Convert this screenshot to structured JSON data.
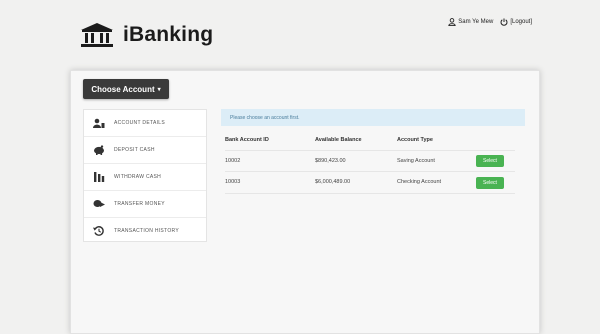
{
  "app": {
    "name": "iBanking"
  },
  "header": {
    "user_label": "Sam Ye Mew",
    "logout_label": "[Logout]"
  },
  "account_menu": {
    "button_label": "Choose Account",
    "caret": "▾"
  },
  "sidebar": {
    "items": [
      {
        "label": "ACCOUNT DETAILS",
        "icon": "bank-icon"
      },
      {
        "label": "DEPOSIT CASH",
        "icon": "piggy-bank-icon"
      },
      {
        "label": "WITHDRAW CASH",
        "icon": "cash-withdraw-icon"
      },
      {
        "label": "TRANSFER MONEY",
        "icon": "transfer-icon"
      },
      {
        "label": "TRANSACTION HISTORY",
        "icon": "history-icon"
      }
    ]
  },
  "alert": {
    "text": "Please choose an account first."
  },
  "accounts_table": {
    "headers": [
      "Bank Account ID",
      "Available Balance",
      "Account Type"
    ],
    "rows": [
      {
        "id": "10002",
        "balance": "$890,423.00",
        "type": "Saving Account",
        "action": "Select"
      },
      {
        "id": "10003",
        "balance": "$6,000,489.00",
        "type": "Checking Account",
        "action": "Select"
      }
    ]
  },
  "colors": {
    "select_button": "#49b352",
    "alert_bg": "#dcedf7",
    "choose_button": "#3a3a3a"
  }
}
